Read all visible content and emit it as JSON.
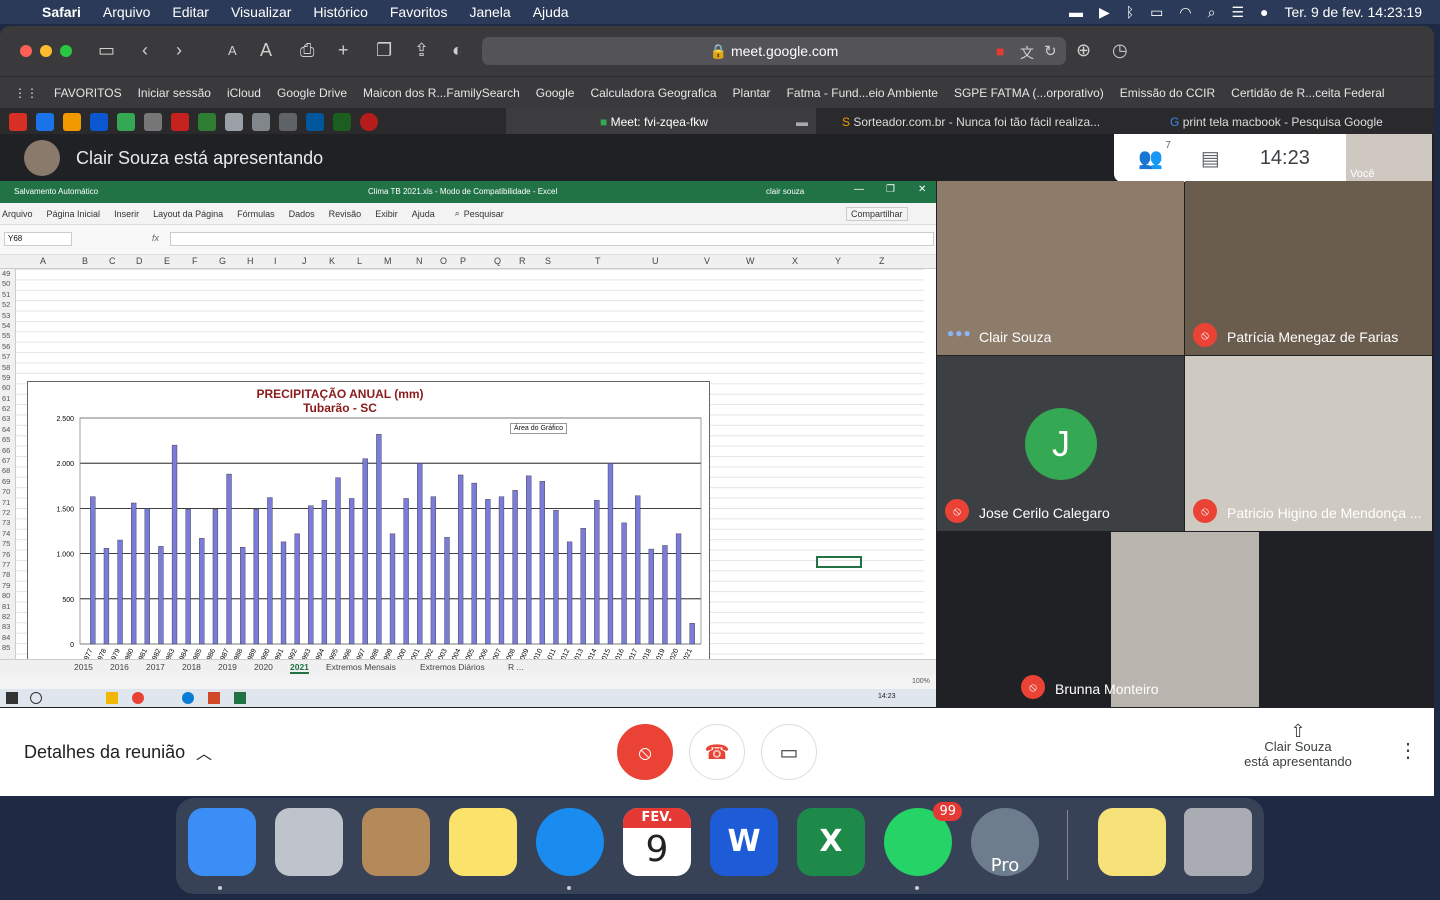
{
  "menubar": {
    "app": "Safari",
    "items": [
      "Arquivo",
      "Editar",
      "Visualizar",
      "Histórico",
      "Favoritos",
      "Janela",
      "Ajuda"
    ],
    "clock": "Ter. 9 de fev.  14:23:19"
  },
  "browser": {
    "url": "meet.google.com",
    "favorites": [
      "FAVORITOS",
      "Iniciar sessão",
      "iCloud",
      "Google Drive",
      "Maicon dos R...FamilySearch",
      "Google",
      "Calculadora Geografica",
      "Plantar",
      "Fatma - Fund...eio Ambiente",
      "SGPE FATMA (...orporativo)",
      "Emissão do CCIR",
      "Certidão de R...ceita Federal"
    ],
    "tabs": [
      "Meet: fvi-zqea-fkw",
      "Sorteador.com.br - Nunca foi tão fácil realiza...",
      "print tela macbook - Pesquisa Google"
    ]
  },
  "meet": {
    "presenter_text": "Clair Souza está apresentando",
    "participant_count": "7",
    "clock": "14:23",
    "self_label": "Você",
    "participants": [
      {
        "name": "Clair Souza",
        "muted": false
      },
      {
        "name": "Patrícia Menegaz de Farias",
        "muted": true
      },
      {
        "name": "Jose Cerilo Calegaro",
        "muted": true,
        "initial": "J"
      },
      {
        "name": "Patricio Higino de Mendonça ...",
        "muted": true
      },
      {
        "name": "Brunna Monteiro",
        "muted": true
      }
    ],
    "details_label": "Detalhes da reunião",
    "presenting_label": "Clair Souza\nestá apresentando"
  },
  "excel": {
    "autosave": "Salvamento Automático",
    "title": "Clima TB 2021.xls  -  Modo de Compatibilidade  -  Excel",
    "user": "clair souza",
    "ribbon": [
      "Arquivo",
      "Página Inicial",
      "Inserir",
      "Layout da Página",
      "Fórmulas",
      "Dados",
      "Revisão",
      "Exibir",
      "Ajuda"
    ],
    "search": "Pesquisar",
    "share": "Compartilhar",
    "namebox": "Y68",
    "columns": [
      "A",
      "B",
      "C",
      "D",
      "E",
      "F",
      "G",
      "H",
      "I",
      "J",
      "K",
      "L",
      "M",
      "N",
      "O",
      "P",
      "Q",
      "R",
      "S",
      "T",
      "U",
      "V",
      "W",
      "X",
      "Y",
      "Z"
    ],
    "rows": [
      "49",
      "50",
      "51",
      "52",
      "53",
      "54",
      "55",
      "56",
      "57",
      "58",
      "59",
      "60",
      "61",
      "62",
      "63",
      "64",
      "65",
      "66",
      "67",
      "68",
      "69",
      "70",
      "71",
      "72",
      "73",
      "74",
      "75",
      "76",
      "77",
      "78",
      "79",
      "80",
      "81",
      "82",
      "83",
      "84",
      "85"
    ],
    "sheet_tabs": [
      "2015",
      "2016",
      "2017",
      "2018",
      "2019",
      "2020",
      "2021",
      "Extremos Mensais",
      "Extremos Diários",
      "R ..."
    ],
    "active_sheet": "2021",
    "zoom": "100%",
    "taskbar_time": "14:23",
    "tooltip": "Área do Gráfico"
  },
  "chart_data": {
    "type": "bar",
    "title": "PRECIPITAÇÃO ANUAL (mm)",
    "subtitle": "Tubarão - SC",
    "xlabel": "",
    "ylabel": "",
    "ylim": [
      0,
      2500
    ],
    "yticks": [
      "0",
      "500",
      "1.000",
      "1.500",
      "2.000",
      "2.500"
    ],
    "categories": [
      "1977",
      "1978",
      "1979",
      "1980",
      "1981",
      "1982",
      "1983",
      "1984",
      "1985",
      "1986",
      "1987",
      "1988",
      "1989",
      "1990",
      "1991",
      "1992",
      "1993",
      "1994",
      "1995",
      "1996",
      "1997",
      "1998",
      "1999",
      "2000",
      "2001",
      "2002",
      "2003",
      "2004",
      "2005",
      "2006",
      "2007",
      "2008",
      "2009",
      "2010",
      "2011",
      "2012",
      "2013",
      "2014",
      "2015",
      "2016",
      "2017",
      "2018",
      "2019",
      "2020",
      "2021"
    ],
    "values": [
      1630,
      1060,
      1150,
      1560,
      1500,
      1080,
      2200,
      1490,
      1170,
      1490,
      1880,
      1070,
      1490,
      1620,
      1130,
      1220,
      1530,
      1590,
      1840,
      1610,
      2050,
      2320,
      1220,
      1610,
      2000,
      1630,
      1180,
      1870,
      1780,
      1600,
      1630,
      1700,
      1860,
      1800,
      1480,
      1130,
      1280,
      1590,
      2000,
      1340,
      1640,
      1050,
      1090,
      1220,
      230
    ],
    "bar_color": "#7b7bd9",
    "grid": true,
    "legend": "none"
  },
  "dock": {
    "apps": [
      "finder-icon",
      "launchpad-icon",
      "contacts-icon",
      "notes-icon",
      "safari-icon",
      "calendar-icon",
      "word-icon",
      "excel-icon",
      "whatsapp-icon",
      "google-earth-pro-icon",
      "stickies-icon",
      "trash-icon"
    ],
    "calendar_month": "FEV.",
    "calendar_day": "9",
    "whatsapp_badge": "99",
    "word_letter": "W",
    "excel_letter": "X",
    "earth_label": "Pro"
  }
}
